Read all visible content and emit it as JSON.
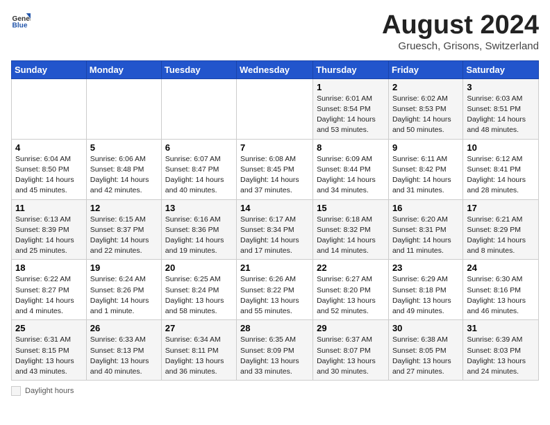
{
  "header": {
    "logo_general": "General",
    "logo_blue": "Blue",
    "month_title": "August 2024",
    "location": "Gruesch, Grisons, Switzerland"
  },
  "days_of_week": [
    "Sunday",
    "Monday",
    "Tuesday",
    "Wednesday",
    "Thursday",
    "Friday",
    "Saturday"
  ],
  "weeks": [
    [
      {
        "num": "",
        "info": ""
      },
      {
        "num": "",
        "info": ""
      },
      {
        "num": "",
        "info": ""
      },
      {
        "num": "",
        "info": ""
      },
      {
        "num": "1",
        "info": "Sunrise: 6:01 AM\nSunset: 8:54 PM\nDaylight: 14 hours and 53 minutes."
      },
      {
        "num": "2",
        "info": "Sunrise: 6:02 AM\nSunset: 8:53 PM\nDaylight: 14 hours and 50 minutes."
      },
      {
        "num": "3",
        "info": "Sunrise: 6:03 AM\nSunset: 8:51 PM\nDaylight: 14 hours and 48 minutes."
      }
    ],
    [
      {
        "num": "4",
        "info": "Sunrise: 6:04 AM\nSunset: 8:50 PM\nDaylight: 14 hours and 45 minutes."
      },
      {
        "num": "5",
        "info": "Sunrise: 6:06 AM\nSunset: 8:48 PM\nDaylight: 14 hours and 42 minutes."
      },
      {
        "num": "6",
        "info": "Sunrise: 6:07 AM\nSunset: 8:47 PM\nDaylight: 14 hours and 40 minutes."
      },
      {
        "num": "7",
        "info": "Sunrise: 6:08 AM\nSunset: 8:45 PM\nDaylight: 14 hours and 37 minutes."
      },
      {
        "num": "8",
        "info": "Sunrise: 6:09 AM\nSunset: 8:44 PM\nDaylight: 14 hours and 34 minutes."
      },
      {
        "num": "9",
        "info": "Sunrise: 6:11 AM\nSunset: 8:42 PM\nDaylight: 14 hours and 31 minutes."
      },
      {
        "num": "10",
        "info": "Sunrise: 6:12 AM\nSunset: 8:41 PM\nDaylight: 14 hours and 28 minutes."
      }
    ],
    [
      {
        "num": "11",
        "info": "Sunrise: 6:13 AM\nSunset: 8:39 PM\nDaylight: 14 hours and 25 minutes."
      },
      {
        "num": "12",
        "info": "Sunrise: 6:15 AM\nSunset: 8:37 PM\nDaylight: 14 hours and 22 minutes."
      },
      {
        "num": "13",
        "info": "Sunrise: 6:16 AM\nSunset: 8:36 PM\nDaylight: 14 hours and 19 minutes."
      },
      {
        "num": "14",
        "info": "Sunrise: 6:17 AM\nSunset: 8:34 PM\nDaylight: 14 hours and 17 minutes."
      },
      {
        "num": "15",
        "info": "Sunrise: 6:18 AM\nSunset: 8:32 PM\nDaylight: 14 hours and 14 minutes."
      },
      {
        "num": "16",
        "info": "Sunrise: 6:20 AM\nSunset: 8:31 PM\nDaylight: 14 hours and 11 minutes."
      },
      {
        "num": "17",
        "info": "Sunrise: 6:21 AM\nSunset: 8:29 PM\nDaylight: 14 hours and 8 minutes."
      }
    ],
    [
      {
        "num": "18",
        "info": "Sunrise: 6:22 AM\nSunset: 8:27 PM\nDaylight: 14 hours and 4 minutes."
      },
      {
        "num": "19",
        "info": "Sunrise: 6:24 AM\nSunset: 8:26 PM\nDaylight: 14 hours and 1 minute."
      },
      {
        "num": "20",
        "info": "Sunrise: 6:25 AM\nSunset: 8:24 PM\nDaylight: 13 hours and 58 minutes."
      },
      {
        "num": "21",
        "info": "Sunrise: 6:26 AM\nSunset: 8:22 PM\nDaylight: 13 hours and 55 minutes."
      },
      {
        "num": "22",
        "info": "Sunrise: 6:27 AM\nSunset: 8:20 PM\nDaylight: 13 hours and 52 minutes."
      },
      {
        "num": "23",
        "info": "Sunrise: 6:29 AM\nSunset: 8:18 PM\nDaylight: 13 hours and 49 minutes."
      },
      {
        "num": "24",
        "info": "Sunrise: 6:30 AM\nSunset: 8:16 PM\nDaylight: 13 hours and 46 minutes."
      }
    ],
    [
      {
        "num": "25",
        "info": "Sunrise: 6:31 AM\nSunset: 8:15 PM\nDaylight: 13 hours and 43 minutes."
      },
      {
        "num": "26",
        "info": "Sunrise: 6:33 AM\nSunset: 8:13 PM\nDaylight: 13 hours and 40 minutes."
      },
      {
        "num": "27",
        "info": "Sunrise: 6:34 AM\nSunset: 8:11 PM\nDaylight: 13 hours and 36 minutes."
      },
      {
        "num": "28",
        "info": "Sunrise: 6:35 AM\nSunset: 8:09 PM\nDaylight: 13 hours and 33 minutes."
      },
      {
        "num": "29",
        "info": "Sunrise: 6:37 AM\nSunset: 8:07 PM\nDaylight: 13 hours and 30 minutes."
      },
      {
        "num": "30",
        "info": "Sunrise: 6:38 AM\nSunset: 8:05 PM\nDaylight: 13 hours and 27 minutes."
      },
      {
        "num": "31",
        "info": "Sunrise: 6:39 AM\nSunset: 8:03 PM\nDaylight: 13 hours and 24 minutes."
      }
    ]
  ],
  "footer": {
    "daylight_label": "Daylight hours"
  }
}
